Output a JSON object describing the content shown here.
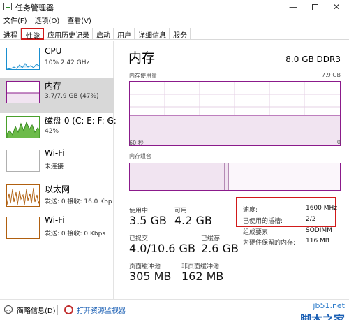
{
  "window": {
    "title": "任务管理器"
  },
  "menu": {
    "items": [
      "文件(F)",
      "选项(O)",
      "查看(V)"
    ]
  },
  "tabs": [
    "进程",
    "性能",
    "应用历史记录",
    "启动",
    "用户",
    "详细信息",
    "服务"
  ],
  "active_tab": "性能",
  "sidebar": {
    "items": [
      {
        "name": "CPU",
        "sub": "10% 2.42 GHz",
        "color": "#1a8fd0"
      },
      {
        "name": "内存",
        "sub": "3.7/7.9 GB (47%)",
        "color": "#8b1a8b"
      },
      {
        "name": "磁盘 0 (C: E: F: G:",
        "sub": "42%",
        "color": "#4aa02c"
      },
      {
        "name": "Wi-Fi",
        "sub": "未连接",
        "color": "#b0b0b0"
      },
      {
        "name": "以太网",
        "sub": "发送: 0 接收: 16.0 Kbp",
        "color": "#b06010"
      },
      {
        "name": "Wi-Fi",
        "sub": "发送: 0 接收: 0 Kbps",
        "color": "#b06010"
      }
    ],
    "selected_index": 1
  },
  "main": {
    "title": "内存",
    "capacity": "8.0 GB DDR3",
    "usage_label": "内存使用量",
    "usage_max": "7.9 GB",
    "time_left": "60 秒",
    "time_right": "0",
    "composition_label": "内存组合",
    "usage_fraction": 0.47,
    "stats": {
      "in_use_label": "使用中",
      "in_use": "3.5 GB",
      "available_label": "可用",
      "available": "4.2 GB",
      "committed_label": "已提交",
      "committed": "4.0/10.6 GB",
      "cached_label": "已缓存",
      "cached": "2.6 GB",
      "paged_label": "页面缓冲池",
      "paged": "305 MB",
      "nonpaged_label": "非页面缓冲池",
      "nonpaged": "162 MB"
    },
    "details": [
      {
        "label": "速度:",
        "value": "1600 MHz"
      },
      {
        "label": "已使用的插槽:",
        "value": "2/2"
      },
      {
        "label": "组成要素:",
        "value": "SODIMM"
      },
      {
        "label": "为硬件保留的内存:",
        "value": "116 MB"
      }
    ]
  },
  "footer": {
    "brief": "简略信息(D)",
    "monitor": "打开资源监视器"
  },
  "watermark": {
    "line1": "jb51.net",
    "line2": "脚本之家"
  }
}
